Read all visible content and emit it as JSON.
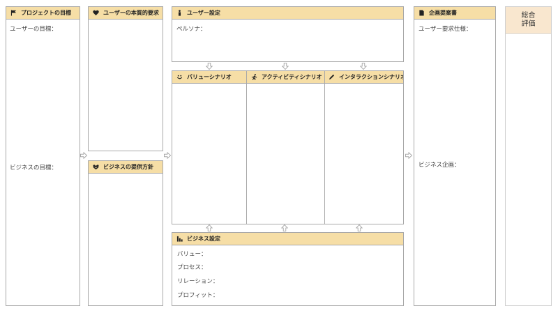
{
  "project_goal": {
    "title": "プロジェクトの目標",
    "user_goal": "ユーザーの目標：",
    "business_goal": "ビジネスの目標："
  },
  "user_needs": {
    "title": "ユーザーの本質的要求"
  },
  "business_policy": {
    "title": "ビジネスの提供方針"
  },
  "user_settings": {
    "title": "ユーザー設定",
    "persona": "ペルソナ："
  },
  "scenarios": {
    "value": "バリューシナリオ",
    "activity": "アクティビティシナリオ",
    "interaction": "インタラクションシナリオ"
  },
  "business_settings": {
    "title": "ビジネス設定",
    "value": "バリュー：",
    "process": "プロセス：",
    "relation": "リレーション：",
    "profit": "プロフィット："
  },
  "proposal": {
    "title": "企画提案書",
    "user_spec": "ユーザー要求仕様：",
    "business_plan": "ビジネス企画："
  },
  "evaluation": {
    "line1": "総合",
    "line2": "評価"
  },
  "colors": {
    "header": "#f6dea6",
    "eval_header": "#f9e7cf",
    "border": "#a8a8a8"
  }
}
